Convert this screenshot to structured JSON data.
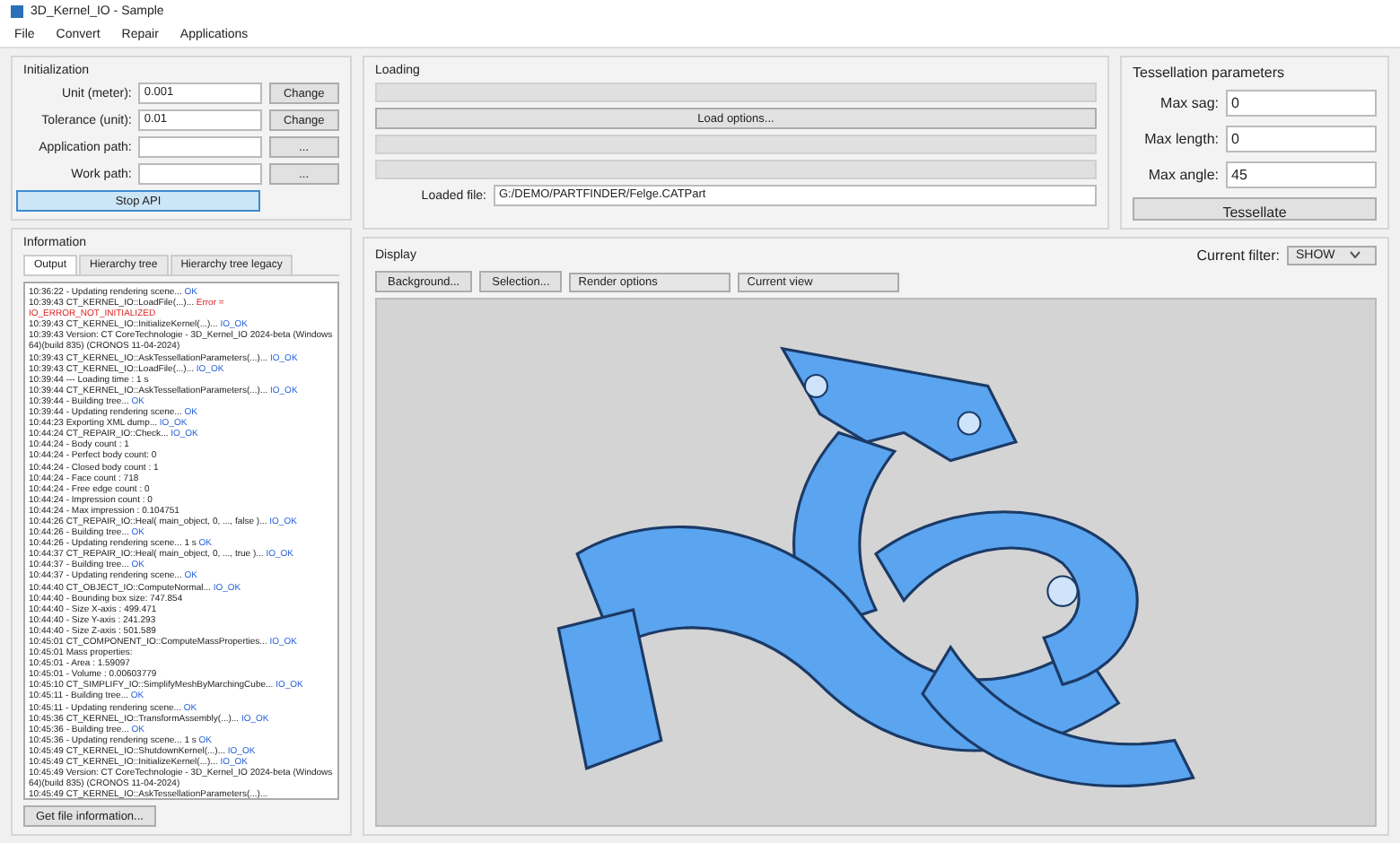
{
  "window": {
    "title": "3D_Kernel_IO - Sample"
  },
  "menu": [
    "File",
    "Convert",
    "Repair",
    "Applications"
  ],
  "initialization": {
    "title": "Initialization",
    "fields": [
      {
        "label": "Unit (meter):",
        "value": "0.001",
        "button": "Change"
      },
      {
        "label": "Tolerance (unit):",
        "value": "0.01",
        "button": "Change"
      },
      {
        "label": "Application path:",
        "button": "..."
      },
      {
        "label": "Work path:",
        "button": "..."
      }
    ],
    "stop_button": "Stop API"
  },
  "loading": {
    "title": "Loading",
    "progress_bars": [
      {
        "level": 0
      },
      {
        "level": 0
      },
      {
        "level": 0
      }
    ],
    "options_button": "Load options...",
    "loaded_file_label": "Loaded file:",
    "loaded_file": "G:/DEMO/PARTFINDER/Felge.CATPart"
  },
  "tessellation": {
    "title": "Tessellation parameters",
    "fields": [
      {
        "label": "Max sag:",
        "value": "0"
      },
      {
        "label": "Max length:",
        "value": "0"
      },
      {
        "label": "Max angle:",
        "value": "45"
      }
    ],
    "button": "Tessellate"
  },
  "information": {
    "title": "Information",
    "tabs": [
      {
        "label": "Output",
        "selected": true
      },
      {
        "label": "Hierarchy tree",
        "selected": false
      },
      {
        "label": "Hierarchy tree legacy",
        "selected": false
      }
    ],
    "log": [
      {
        "time": "10:36:22",
        "text": "- Updating rendering scene...",
        "result": "OK",
        "kind": "ok"
      },
      {
        "time": "10:39:43",
        "text": "CT_KERNEL_IO::LoadFile(...)...",
        "result": "Error = IO_ERROR_NOT_INITIALIZED",
        "kind": "error"
      },
      {
        "time": "10:39:43",
        "text": "CT_KERNEL_IO::InitializeKernel(...)...",
        "result": "IO_OK",
        "kind": "ok"
      },
      {
        "time": "10:39:43",
        "text": "Version: CT CoreTechnologie - 3D_Kernel_IO 2024-beta (Windows 64)(build 835) (CRONOS 11-04-2024)"
      },
      {
        "time": "10:39:43",
        "text": "CT_KERNEL_IO::AskTessellationParameters(...)...",
        "result": "IO_OK",
        "kind": "ok"
      },
      {
        "time": "10:39:43",
        "text": "CT_KERNEL_IO::LoadFile(...)...",
        "result": "IO_OK",
        "kind": "ok"
      },
      {
        "time": "10:39:44",
        "text": "--- Loading time : 1 s"
      },
      {
        "time": "10:39:44",
        "text": "CT_KERNEL_IO::AskTessellationParameters(...)...",
        "result": "IO_OK",
        "kind": "ok"
      },
      {
        "time": "10:39:44",
        "text": "- Building tree...",
        "result": "OK",
        "kind": "ok"
      },
      {
        "time": "10:39:44",
        "text": "- Updating rendering scene...",
        "result": "OK",
        "kind": "ok"
      },
      {
        "time": "10:44:23",
        "text": "Exporting XML dump...",
        "result": "IO_OK",
        "kind": "ok"
      },
      {
        "time": "10:44:24",
        "text": "CT_REPAIR_IO::Check...",
        "result": "IO_OK",
        "kind": "ok"
      },
      {
        "time": "10:44:24",
        "text": "- Body count : 1"
      },
      {
        "time": "10:44:24",
        "text": "- Perfect body count: 0"
      },
      {
        "time": "10:44:24",
        "text": "- Closed body count : 1"
      },
      {
        "time": "10:44:24",
        "text": "- Face count : 718"
      },
      {
        "time": "10:44:24",
        "text": "- Free edge count : 0"
      },
      {
        "time": "10:44:24",
        "text": "- Impression count : 0"
      },
      {
        "time": "10:44:24",
        "text": "- Max impression : 0.104751"
      },
      {
        "time": "10:44:26",
        "text": "CT_REPAIR_IO::Heal( main_object, 0, ..., false )...",
        "result": "IO_OK",
        "kind": "ok"
      },
      {
        "time": "10:44:26",
        "text": "- Building tree...",
        "result": "OK",
        "kind": "ok"
      },
      {
        "time": "10:44:26",
        "text": "- Updating rendering scene... 1 s",
        "result": "OK",
        "kind": "ok"
      },
      {
        "time": "10:44:37",
        "text": "CT_REPAIR_IO::Heal( main_object, 0, ..., true )...",
        "result": "IO_OK",
        "kind": "ok"
      },
      {
        "time": "10:44:37",
        "text": "- Building tree...",
        "result": "OK",
        "kind": "ok"
      },
      {
        "time": "10:44:37",
        "text": "- Updating rendering scene...",
        "result": "OK",
        "kind": "ok"
      },
      {
        "time": "10:44:40",
        "text": "CT_OBJECT_IO::ComputeNormal...",
        "result": "IO_OK",
        "kind": "ok"
      },
      {
        "time": "10:44:40",
        "text": "- Bounding box size: 747.854"
      },
      {
        "time": "10:44:40",
        "text": "- Size X-axis : 499.471"
      },
      {
        "time": "10:44:40",
        "text": "- Size Y-axis : 241.293"
      },
      {
        "time": "10:44:40",
        "text": "- Size Z-axis : 501.589"
      },
      {
        "time": "10:45:01",
        "text": "CT_COMPONENT_IO::ComputeMassProperties...",
        "result": "IO_OK",
        "kind": "ok"
      },
      {
        "time": "10:45:01",
        "text": "Mass properties:"
      },
      {
        "time": "10:45:01",
        "text": "- Area : 1.59097"
      },
      {
        "time": "10:45:01",
        "text": "- Volume : 0.00603779"
      },
      {
        "time": "10:45:10",
        "text": "CT_SIMPLIFY_IO::SimplifyMeshByMarchingCube...",
        "result": "IO_OK",
        "kind": "ok"
      },
      {
        "time": "10:45:11",
        "text": "- Building tree...",
        "result": "OK",
        "kind": "ok"
      },
      {
        "time": "10:45:11",
        "text": "- Updating rendering scene...",
        "result": "OK",
        "kind": "ok"
      },
      {
        "time": "10:45:36",
        "text": "CT_KERNEL_IO::TransformAssembly(...)...",
        "result": "IO_OK",
        "kind": "ok"
      },
      {
        "time": "10:45:36",
        "text": "- Building tree...",
        "result": "OK",
        "kind": "ok"
      },
      {
        "time": "10:45:36",
        "text": "- Updating rendering scene... 1 s",
        "result": "OK",
        "kind": "ok"
      },
      {
        "time": "10:45:49",
        "text": "CT_KERNEL_IO::ShutdownKernel(...)...",
        "result": "IO_OK",
        "kind": "ok"
      },
      {
        "time": "10:45:49",
        "text": "CT_KERNEL_IO::InitializeKernel(...)...",
        "result": "IO_OK",
        "kind": "ok"
      },
      {
        "time": "10:45:49",
        "text": "Version: CT CoreTechnologie - 3D_Kernel_IO 2024-beta (Windows 64)(build 835) (CRONOS 11-04-2024)"
      },
      {
        "time": "10:45:49",
        "text": "CT_KERNEL_IO::AskTessellationParameters(...)..."
      }
    ],
    "file_info_button": "Get file information..."
  },
  "display": {
    "title": "Display",
    "buttons": [
      "Background...",
      "Selection..."
    ],
    "dropdowns": [
      "Render options",
      "Current view"
    ],
    "filter_label": "Current filter:",
    "filter_value": "SHOW"
  }
}
